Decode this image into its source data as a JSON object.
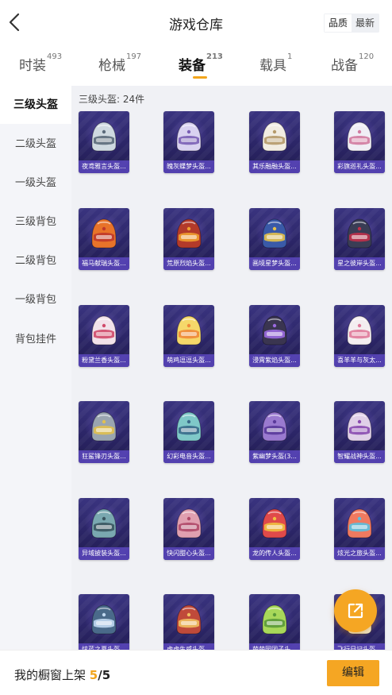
{
  "header": {
    "title": "游戏仓库",
    "sort_options": [
      "品质",
      "最新"
    ],
    "sort_active": "品质"
  },
  "tabs": [
    {
      "label": "时装",
      "count": "493"
    },
    {
      "label": "枪械",
      "count": "197"
    },
    {
      "label": "装备",
      "count": "213"
    },
    {
      "label": "载具",
      "count": "1"
    },
    {
      "label": "战备",
      "count": "120"
    }
  ],
  "sidebar": {
    "items": [
      {
        "label": "三级头盔"
      },
      {
        "label": "二级头盔"
      },
      {
        "label": "一级头盔"
      },
      {
        "label": "三级背包"
      },
      {
        "label": "二级背包"
      },
      {
        "label": "一级背包"
      },
      {
        "label": "背包挂件"
      }
    ]
  },
  "grid": {
    "section_title": "三级头盔: 24件",
    "items": [
      {
        "name": "夜鸢雅言头盔...",
        "color": "#cfd9e0",
        "accent": "#5b6a7a"
      },
      {
        "name": "魄灰蝶梦头盔...",
        "color": "#d9d2f0",
        "accent": "#7a5fb5"
      },
      {
        "name": "其乐融融头盔...",
        "color": "#f1ece2",
        "accent": "#b59a6a"
      },
      {
        "name": "彩旗巡礼头盔...",
        "color": "#f0eef5",
        "accent": "#d17aa0"
      },
      {
        "name": "福马献瑞头盔...",
        "color": "#e8732a",
        "accent": "#c0392b"
      },
      {
        "name": "荒原烈焰头盔...",
        "color": "#b33a2a",
        "accent": "#f0a030"
      },
      {
        "name": "画境星梦头盔...",
        "color": "#3a5aa8",
        "accent": "#e6c14a"
      },
      {
        "name": "星之彼岸头盔...",
        "color": "#3a3d55",
        "accent": "#c0304a"
      },
      {
        "name": "粉黛兰香头盔...",
        "color": "#f2e2ea",
        "accent": "#d04a6a"
      },
      {
        "name": "萌鸡逗逗头盔...",
        "color": "#f5d86a",
        "accent": "#f08a3a"
      },
      {
        "name": "浸霄紫焰头盔...",
        "color": "#3a3550",
        "accent": "#9b6ae0"
      },
      {
        "name": "喜羊羊与灰太...",
        "color": "#f4eef0",
        "accent": "#e07a9a"
      },
      {
        "name": "狂鲨锋刃头盔...",
        "color": "#9aa5b0",
        "accent": "#e0c050"
      },
      {
        "name": "幻彩电音头盔...",
        "color": "#7fc8c8",
        "accent": "#3a6a8a"
      },
      {
        "name": "紫幽梦头盔(3...",
        "color": "#9a7ad0",
        "accent": "#5a3a9a"
      },
      {
        "name": "智耀战神头盔...",
        "color": "#e0d0e8",
        "accent": "#8a4ab0"
      },
      {
        "name": "异域披装头盔...",
        "color": "#7aa8b0",
        "accent": "#3a5560"
      },
      {
        "name": "快闪甜心头盔...",
        "color": "#e0a0b0",
        "accent": "#b04a6a"
      },
      {
        "name": "龙的传人头盔...",
        "color": "#e04a4a",
        "accent": "#f0c040"
      },
      {
        "name": "炫光之旅头盔...",
        "color": "#f07a60",
        "accent": "#5ac0e0"
      },
      {
        "name": "炫蓝之夏头盔...",
        "color": "#4a6a8a",
        "accent": "#c0d8f0"
      },
      {
        "name": "虎虎生威头盔...",
        "color": "#c04a3a",
        "accent": "#f0c060"
      },
      {
        "name": "萌萌园团子头...",
        "color": "#a8d85a",
        "accent": "#5a9a3a"
      },
      {
        "name": "飞行日记头盔...",
        "color": "#f0e8d0",
        "accent": "#a06ac0"
      }
    ]
  },
  "fab": {
    "icon": "share-export-icon"
  },
  "bottom": {
    "label": "我的橱窗上架",
    "count": "5",
    "separator": "/",
    "total": "5",
    "edit_label": "编辑"
  },
  "colors": {
    "accent": "#f5a623",
    "card_bg": "#2b2566",
    "sidebar_bg": "#f4f5f9",
    "grid_bg": "#f0f1f5"
  }
}
